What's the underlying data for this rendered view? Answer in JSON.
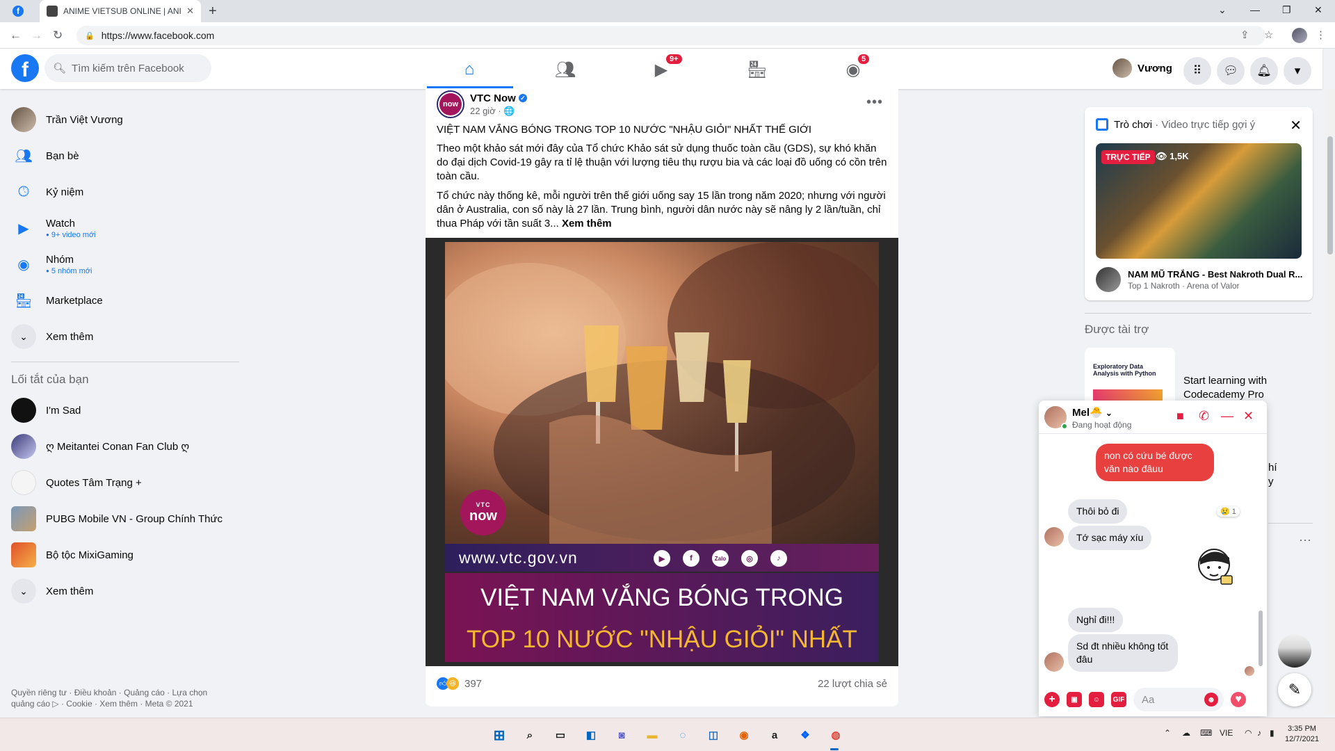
{
  "browser": {
    "tab_title": "ANIME VIETSUB ONLINE | ANIME",
    "url": "https://www.facebook.com"
  },
  "header": {
    "search_placeholder": "Tìm kiếm trên Facebook",
    "watch_badge": "9+",
    "groups_badge": "5",
    "user_name": "Vương"
  },
  "sidebar": {
    "items": [
      {
        "label": "Trần Việt Vương",
        "icon": "profile-avatar"
      },
      {
        "label": "Bạn bè",
        "icon": "friends-icon"
      },
      {
        "label": "Kỷ niệm",
        "icon": "memories-icon"
      },
      {
        "label": "Watch",
        "sub": "9+ video mới",
        "icon": "watch-icon"
      },
      {
        "label": "Nhóm",
        "sub": "5 nhóm mới",
        "icon": "groups-icon"
      },
      {
        "label": "Marketplace",
        "icon": "marketplace-icon"
      },
      {
        "label": "Xem thêm",
        "icon": "chevron-down-icon"
      }
    ],
    "shortcuts_title": "Lối tắt của bạn",
    "shortcuts": [
      {
        "label": "I'm Sad"
      },
      {
        "label": "ღ Meitantei Conan Fan Club ღ"
      },
      {
        "label": "Quotes Tâm Trạng +"
      },
      {
        "label": "PUBG Mobile VN - Group Chính Thức"
      },
      {
        "label": "Bộ tộc MixiGaming"
      },
      {
        "label": "Xem thêm"
      }
    ],
    "footer_line1": "Quyền riêng tư · Điều khoản · Quảng cáo · Lựa chọn",
    "footer_line2": "quảng cáo ▷ · Cookie · Xem thêm · Meta © 2021"
  },
  "post": {
    "page_name": "VTC Now",
    "avatar_text": "now",
    "time": "22 giờ · 🌐",
    "title": "VIỆT NAM VẮNG BÓNG TRONG TOP 10 NƯỚC \"NHẬU GIỎI\" NHẤT THẾ GIỚI",
    "para1": "Theo một khảo sát mới đây của Tổ chức Khảo sát sử dụng thuốc toàn cầu (GDS), sự khó khăn do đại dịch Covid-19 gây ra tỉ lệ thuận với lượng tiêu thụ rượu bia và các loại đồ uống có cồn trên toàn cầu.",
    "para2": "Tổ chức này thống kê, mỗi người trên thế giới uống say 15 lần trong năm 2020; nhưng với người dân ở Australia, con số này là 27 lần. Trung bình, người dân nước này sẽ nâng ly 2 lần/tuần, chỉ thua Pháp với tần suất 3... ",
    "see_more": "Xem thêm",
    "image": {
      "logo_top": "VTC",
      "logo_bottom": "now",
      "website": "www.vtc.gov.vn",
      "headline1": "VIỆT NAM VẮNG BÓNG TRONG",
      "headline2": "TOP 10 NƯỚC \"NHẬU GIỎI\" NHẤT"
    },
    "reactions_count": "397",
    "shares": "22 lượt chia sẻ"
  },
  "right_rail": {
    "game_card": {
      "title": "Trò chơi",
      "subtitle": " · Video trực tiếp gợi ý",
      "live_label": "TRỰC TIẾP",
      "viewers": "1,5K",
      "stream_title": "NAM MŨ TRẮNG - Best Nakroth Dual R...",
      "stream_sub": "Top 1 Nakroth · Arena of Valor"
    },
    "sponsored_title": "Được tài trợ",
    "ad": {
      "image_text": "Exploratory Data Analysis with Python",
      "title": "Start learning with Codecademy Pro"
    }
  },
  "chat": {
    "name": "Mel🐣",
    "status": "Đang hoạt động",
    "messages": [
      {
        "from": "me",
        "text": "non có cứu bé được văn nào đâuu"
      },
      {
        "from": "them",
        "text": "Thôi bỏ đi"
      },
      {
        "from": "them",
        "text": "Tớ sạc máy xíu"
      },
      {
        "from": "them",
        "text": "Nghỉ đi!!!"
      },
      {
        "from": "them",
        "text": "Sd đt nhiều không tốt đâu"
      }
    ],
    "reaction": "😢 1",
    "input_placeholder": "Aa",
    "gif_label": "GIF"
  },
  "taskbar": {
    "lang": "VIE",
    "time": "3:35 PM",
    "date": "12/7/2021"
  }
}
